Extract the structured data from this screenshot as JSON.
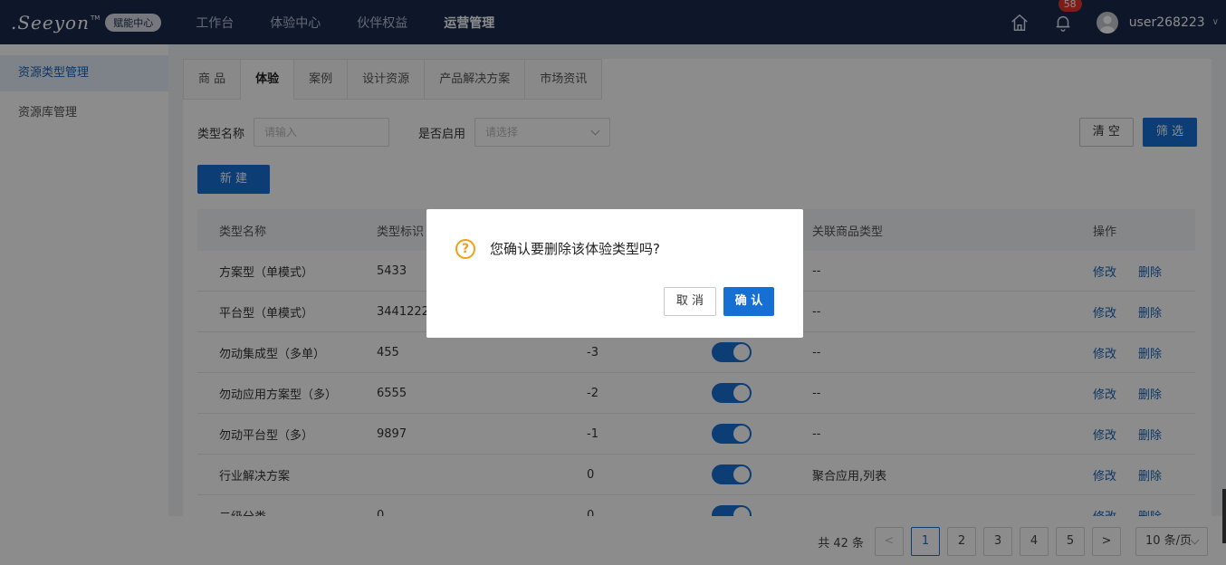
{
  "header": {
    "logo_text": ".Seeyon",
    "logo_tm": "TM",
    "logo_badge": "赋能中心",
    "nav": [
      "工作台",
      "体验中心",
      "伙伴权益",
      "运营管理"
    ],
    "nav_active_index": 3,
    "notification_count": "58",
    "username": "user268223",
    "chevron": "∨"
  },
  "sidebar": {
    "items": [
      "资源类型管理",
      "资源库管理"
    ],
    "active_index": 0
  },
  "tabs": [
    "商 品",
    "体验",
    "案例",
    "设计资源",
    "产品解决方案",
    "市场资讯"
  ],
  "tabs_active_index": 1,
  "filter": {
    "name_label": "类型名称",
    "name_placeholder": "请输入",
    "enabled_label": "是否启用",
    "enabled_placeholder": "请选择",
    "clear_label": "清 空",
    "filter_label": "筛 选"
  },
  "new_label": "新 建",
  "table": {
    "headers": [
      "类型名称",
      "类型标识",
      "",
      "",
      "关联商品类型",
      "操作"
    ],
    "rows": [
      {
        "name": "方案型（单模式）",
        "code": "5433",
        "sort": "",
        "linked": "--"
      },
      {
        "name": "平台型（单模式）",
        "code": "3441222",
        "sort": "",
        "linked": "--"
      },
      {
        "name": "勿动集成型（多单）",
        "code": "455",
        "sort": "-3",
        "linked": "--"
      },
      {
        "name": "勿动应用方案型（多）",
        "code": "6555",
        "sort": "-2",
        "linked": "--"
      },
      {
        "name": "勿动平台型（多）",
        "code": "9897",
        "sort": "-1",
        "linked": "--"
      },
      {
        "name": "行业解决方案",
        "code": "",
        "sort": "0",
        "linked": "聚合应用,列表"
      },
      {
        "name": "二级分类",
        "code": "0",
        "sort": "0",
        "linked": ""
      }
    ],
    "edit_label": "修改",
    "delete_label": "删除"
  },
  "pager": {
    "total": "共 42 条",
    "pages": [
      "1",
      "2",
      "3",
      "4",
      "5"
    ],
    "active_page": "1",
    "page_size": "10 条/页",
    "prev": "<",
    "next": ">"
  },
  "modal": {
    "icon": "?",
    "message": "您确认要删除该体验类型吗?",
    "cancel_label": "取 消",
    "ok_label": "确 认"
  },
  "colors": {
    "primary": "#1670d4",
    "header_bg": "#1b2a4e",
    "warning": "#f2a117",
    "badge": "#e2352d"
  }
}
